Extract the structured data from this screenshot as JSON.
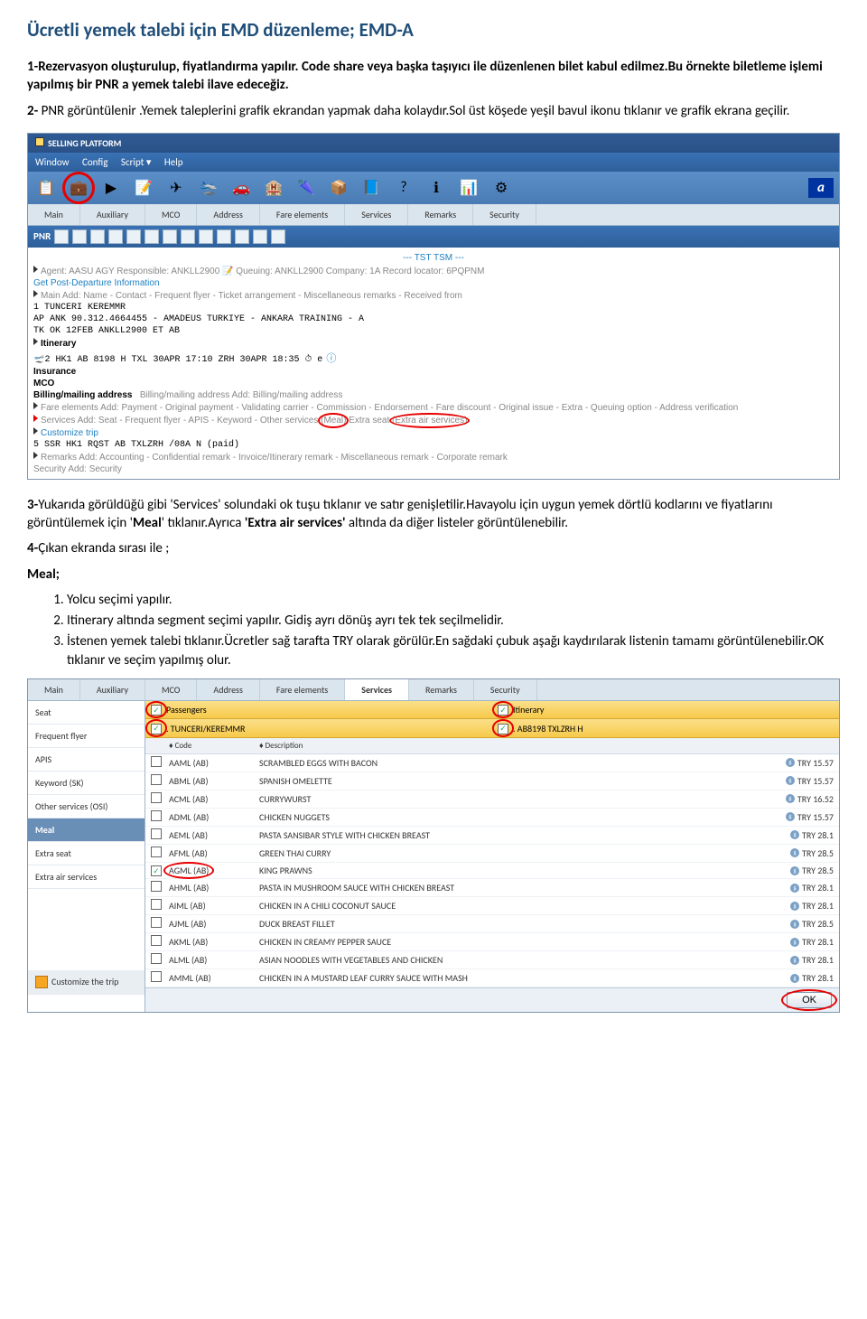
{
  "doc": {
    "title": "Ücretli yemek talebi için EMD düzenleme; EMD-A",
    "p1": "1-Rezervasyon oluşturulup, fiyatlandırma yapılır. Code share veya başka taşıyıcı ile düzenlenen bilet kabul edilmez.Bu örnekte biletleme işlemi yapılmış bir PNR a yemek talebi ilave edeceğiz.",
    "p2a": "2-",
    "p2b": " PNR görüntülenir .Yemek taleplerini grafik ekrandan yapmak daha kolaydır.Sol üst köşede yeşil bavul ikonu tıklanır ve grafik ekrana geçilir.",
    "p3a": "3-",
    "p3b": "Yukarıda görüldüğü gibi 'Services' solundaki ok tuşu tıklanır ve satır genişletilir.Havayolu için uygun yemek dörtlü kodlarını ve fiyatlarını görüntülemek için '",
    "p3meal": "Meal",
    "p3c": "' tıklanır.Ayrıca ",
    "p3extra": "'Extra air services'",
    "p3d": " altında da diğer listeler görüntülenebilir.",
    "p4a": "4-",
    "p4b": "Çıkan ekranda sırası ile ;",
    "mealhdr": "Meal;",
    "li1": "Yolcu seçimi yapılır.",
    "li2": "Itinerary altında segment seçimi yapılır. Gidiş ayrı dönüş ayrı tek tek seçilmelidir.",
    "li3": "İstenen yemek talebi tıklanır.Ücretler sağ tarafta TRY olarak görülür.En sağdaki çubuk aşağı kaydırılarak listenin tamamı görüntülenebilir.OK tıklanır ve seçim yapılmış olur."
  },
  "ss1": {
    "title": "SELLING PLATFORM",
    "menu": [
      "Window",
      "Config",
      "Script ▾",
      "Help"
    ],
    "toolicons": [
      "📋",
      "💼",
      "▶",
      "📝",
      "✈",
      "🛬",
      "🚗",
      "🏨",
      "🌂",
      "📦",
      "📘",
      "?",
      "ℹ",
      "📊",
      "⚙"
    ],
    "wtabs": [
      "Main",
      "Auxiliary",
      "MCO",
      "Address",
      "Fare elements",
      "Services",
      "Remarks",
      "Security"
    ],
    "pnr_label": "PNR",
    "tst": "--- TST TSM ---",
    "agent": "Agent: AASU AGY   Responsible: ANKLL2900   📝   Queuing: ANKLL2900   Company: 1A   Record locator: 6PQPNM",
    "getpost": "Get Post-Departure Information",
    "mainadd": "Main   Add: Name - Contact - Frequent flyer - Ticket arrangement - Miscellaneous remarks - Received from",
    "pax": "    1 TUNCERI KEREMMR",
    "ap": "    AP ANK 90.312.4664455 - AMADEUS TURKIYE - ANKARA TRAINING - A",
    "tk": "    TK OK 12FEB ANKLL2900 ET AB",
    "itnhdr": "Itinerary",
    "itn": "🛫2   HK1   AB     8198    H   TXL       30APR  17:10   ZRH 30APR  18:35  ⏱  e",
    "ins": "Insurance",
    "mco": "MCO",
    "billing": "Billing/mailing address   Add: Billing/mailing address",
    "fare": "Fare elements   Add: Payment - Original payment - Validating carrier - Commission - Endorsement - Fare discount - Original issue - Extra - Queuing option - Address verification",
    "services_pre": "Services   Add: Seat - Frequent flyer - APIS - Keyword - Other services (",
    "services_meal": "Meal",
    "services_mid": ") Extra seat (",
    "services_extra": "Extra air services",
    "customize": "Customize trip",
    "ssr": "    5 SSR HK1 RQST AB TXLZRH /08A N (paid)",
    "remarks": "Remarks   Add: Accounting - Confidential remark - Invoice/Itinerary remark - Miscellaneous remark - Corporate remark",
    "security": "Security   Add: Security"
  },
  "ss2": {
    "wtabs": [
      "Main",
      "Auxiliary",
      "MCO",
      "Address",
      "Fare elements",
      "Services",
      "Remarks",
      "Security"
    ],
    "left": [
      "Seat",
      "Frequent flyer",
      "APIS",
      "Keyword (SK)",
      "Other services (OSI)",
      "Meal",
      "Extra seat",
      "Extra air services"
    ],
    "customize": "Customize the trip",
    "passengers_label": "Passengers",
    "itinerary_label": "Itinerary",
    "pax_row": ". TUNCERI/KEREMMR",
    "itn_row": ". AB8198 TXLZRH H",
    "hdr_code": "♦ Code",
    "hdr_desc": "♦ Description",
    "meals": [
      {
        "code": "AAML (AB)",
        "desc": "SCRAMBLED EGGS WITH BACON",
        "price": "TRY 15.57"
      },
      {
        "code": "ABML (AB)",
        "desc": "SPANISH OMELETTE",
        "price": "TRY 15.57"
      },
      {
        "code": "ACML (AB)",
        "desc": "CURRYWURST",
        "price": "TRY 16.52"
      },
      {
        "code": "ADML (AB)",
        "desc": "CHICKEN NUGGETS",
        "price": "TRY 15.57"
      },
      {
        "code": "AEML (AB)",
        "desc": "PASTA SANSIBAR STYLE WITH CHICKEN BREAST",
        "price": "TRY 28.1"
      },
      {
        "code": "AFML (AB)",
        "desc": "GREEN THAI CURRY",
        "price": "TRY 28.5"
      },
      {
        "code": "AGML (AB)",
        "desc": "KING PRAWNS",
        "price": "TRY 28.5"
      },
      {
        "code": "AHML (AB)",
        "desc": "PASTA IN MUSHROOM SAUCE WITH CHICKEN BREAST",
        "price": "TRY 28.1"
      },
      {
        "code": "AIML (AB)",
        "desc": "CHICKEN IN A CHILI COCONUT SAUCE",
        "price": "TRY 28.1"
      },
      {
        "code": "AJML (AB)",
        "desc": "DUCK BREAST FILLET",
        "price": "TRY 28.5"
      },
      {
        "code": "AKML (AB)",
        "desc": "CHICKEN IN CREAMY PEPPER SAUCE",
        "price": "TRY 28.1"
      },
      {
        "code": "ALML (AB)",
        "desc": "ASIAN NOODLES WITH VEGETABLES AND CHICKEN",
        "price": "TRY 28.1"
      },
      {
        "code": "AMML (AB)",
        "desc": "CHICKEN IN A MUSTARD LEAF CURRY SAUCE WITH MASH",
        "price": "TRY 28.1"
      }
    ],
    "ok": "OK"
  }
}
